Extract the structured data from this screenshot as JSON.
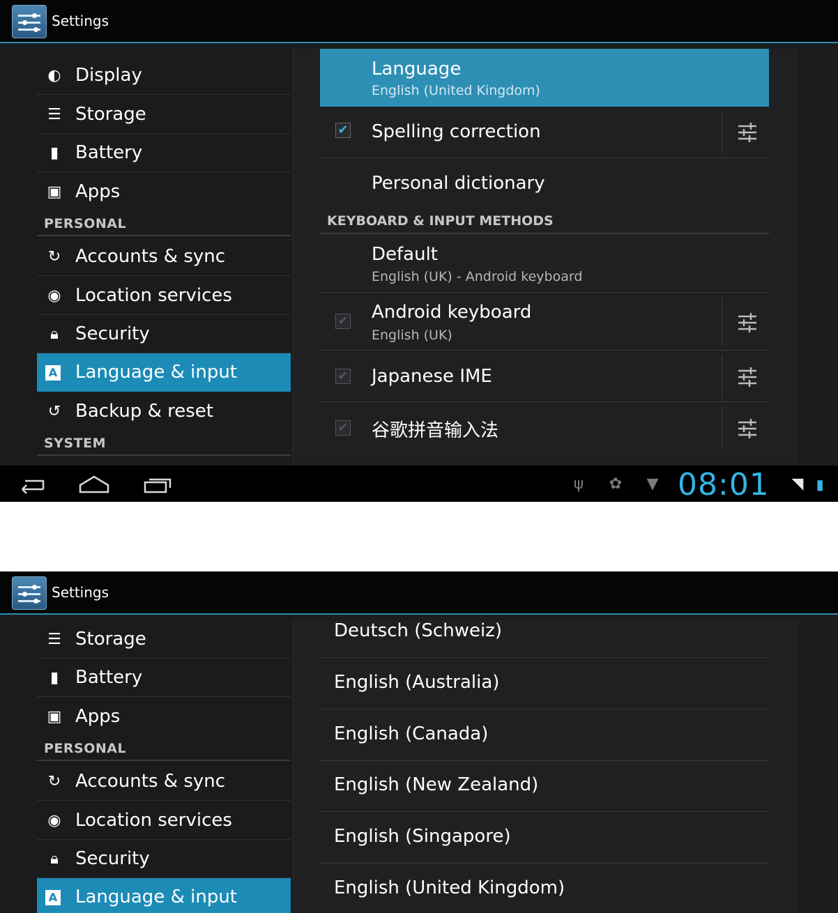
{
  "screens": [
    {
      "title": "Settings",
      "nav": [
        {
          "icon": "display-icon",
          "label": "Display"
        },
        {
          "icon": "storage-icon",
          "label": "Storage"
        },
        {
          "icon": "battery-icon",
          "label": "Battery"
        },
        {
          "icon": "apps-icon",
          "label": "Apps"
        },
        {
          "header": "PERSONAL"
        },
        {
          "icon": "sync-icon",
          "label": "Accounts & sync"
        },
        {
          "icon": "location-icon",
          "label": "Location services"
        },
        {
          "icon": "lock-icon",
          "label": "Security"
        },
        {
          "icon": "language-icon",
          "label": "Language & input",
          "active": true
        },
        {
          "icon": "backup-icon",
          "label": "Backup & reset"
        },
        {
          "header": "SYSTEM"
        }
      ],
      "main": {
        "language": {
          "title": "Language",
          "summary": "English (United Kingdom)"
        },
        "spelling": {
          "title": "Spelling correction",
          "checked": true
        },
        "dictionary": {
          "title": "Personal dictionary"
        },
        "section_header": "KEYBOARD & INPUT METHODS",
        "default": {
          "title": "Default",
          "summary": "English (UK) - Android keyboard"
        },
        "methods": [
          {
            "title": "Android keyboard",
            "summary": "English (UK)",
            "checked": true
          },
          {
            "title": "Japanese IME",
            "checked": true
          },
          {
            "title": "谷歌拼音输入法",
            "checked": true
          }
        ]
      },
      "status_bar": {
        "clock": "08:01"
      }
    },
    {
      "title": "Settings",
      "nav": [
        {
          "icon": "storage-icon",
          "label": "Storage"
        },
        {
          "icon": "battery-icon",
          "label": "Battery"
        },
        {
          "icon": "apps-icon",
          "label": "Apps"
        },
        {
          "header": "PERSONAL"
        },
        {
          "icon": "sync-icon",
          "label": "Accounts & sync"
        },
        {
          "icon": "location-icon",
          "label": "Location services"
        },
        {
          "icon": "lock-icon",
          "label": "Security"
        },
        {
          "icon": "language-icon",
          "label": "Language & input",
          "active": true
        }
      ],
      "languages": [
        "Deutsch (Schweiz)",
        "English (Australia)",
        "English (Canada)",
        "English (New Zealand)",
        "English (Singapore)",
        "English (United Kingdom)"
      ]
    }
  ],
  "colors": {
    "accent": "#33b5e5",
    "selected": "#1c8bb6"
  }
}
